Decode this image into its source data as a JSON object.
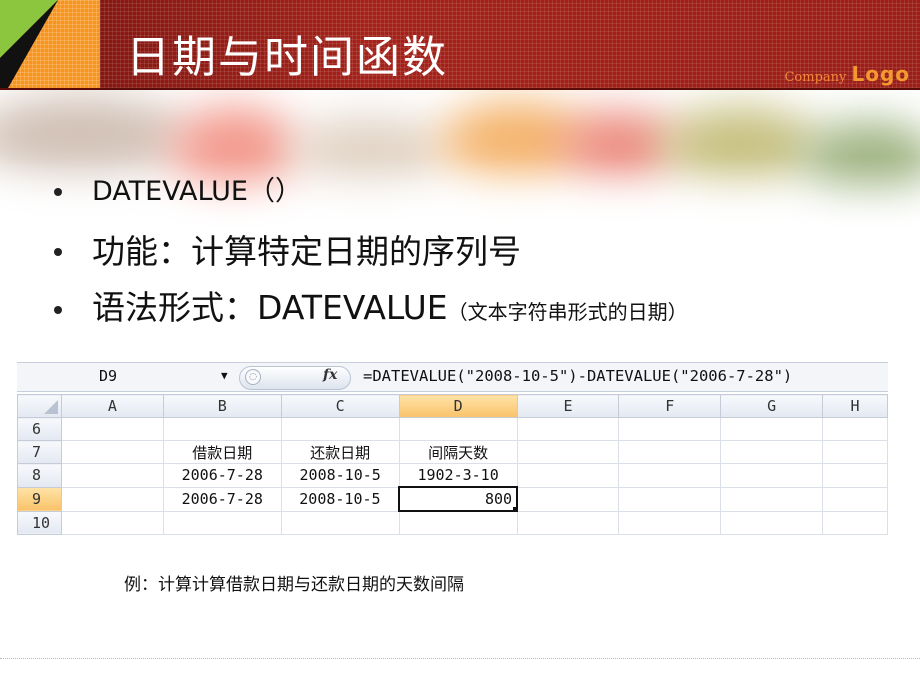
{
  "header": {
    "title": "日期与时间函数",
    "company": "Company",
    "logo": "Logo"
  },
  "bullets": [
    {
      "text": "DATEVALUE（）"
    },
    {
      "text": "功能：计算特定日期的序列号"
    },
    {
      "text": "语法形式：DATEVALUE",
      "small": "（文本字符串形式的日期）"
    }
  ],
  "spreadsheet": {
    "name_box": "D9",
    "fx_icon": "fx",
    "formula": "=DATEVALUE(\"2008-10-5\")-DATEVALUE(\"2006-7-28\")",
    "columns": [
      "A",
      "B",
      "C",
      "D",
      "E",
      "F",
      "G",
      "H"
    ],
    "rows": [
      {
        "num": "6",
        "cells": [
          "",
          "",
          "",
          "",
          "",
          "",
          "",
          ""
        ]
      },
      {
        "num": "7",
        "cells": [
          "",
          "借款日期",
          "还款日期",
          "间隔天数",
          "",
          "",
          "",
          ""
        ]
      },
      {
        "num": "8",
        "cells": [
          "",
          "2006-7-28",
          "2008-10-5",
          "1902-3-10",
          "",
          "",
          "",
          ""
        ]
      },
      {
        "num": "9",
        "cells": [
          "",
          "2006-7-28",
          "2008-10-5",
          "800",
          "",
          "",
          "",
          ""
        ]
      },
      {
        "num": "10",
        "cells": [
          "",
          "",
          "",
          "",
          "",
          "",
          "",
          ""
        ]
      }
    ],
    "selected_cell": "D9"
  },
  "caption": "例：计算计算借款日期与还款日期的天数间隔",
  "colors": {
    "header_red": "#8e1a12",
    "logo_orange": "#f39a2e",
    "corner_green": "#8cc63f",
    "corner_orange": "#f7941d"
  }
}
